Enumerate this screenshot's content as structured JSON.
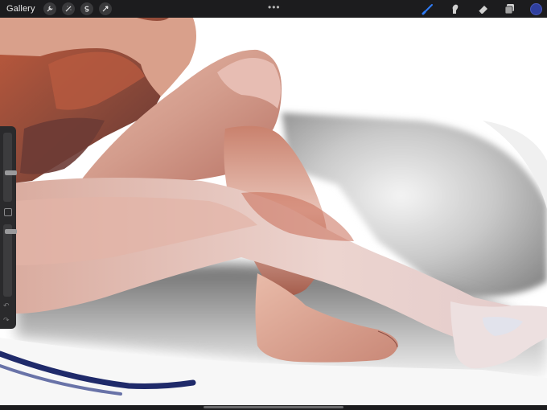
{
  "topbar": {
    "gallery_label": "Gallery",
    "left_tools": [
      "wrench-icon",
      "magic-wand-icon",
      "selection-icon",
      "transform-icon"
    ],
    "more_label": "•••",
    "right_tools": [
      "brush-icon",
      "smudge-icon",
      "eraser-icon",
      "layers-icon"
    ],
    "active_tool": "brush-icon",
    "current_color": "#2f3f9e"
  },
  "sidebar": {
    "brush_size_level": 0.28,
    "opacity_level": 0.08,
    "undo_label": "↶",
    "redo_label": "↷"
  },
  "colors": {
    "accent": "#2f7cf6",
    "toolbar_bg": "#1c1c1e"
  }
}
